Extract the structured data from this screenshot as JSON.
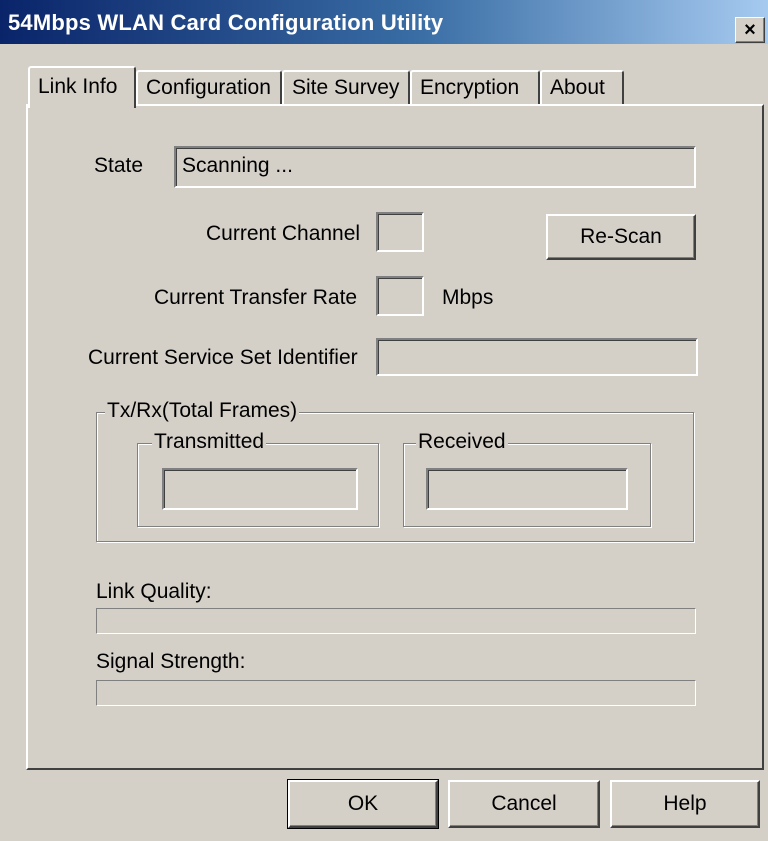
{
  "window": {
    "title": "54Mbps WLAN Card Configuration Utility",
    "close_label": "×"
  },
  "tabs": [
    {
      "label": "Link Info",
      "active": true
    },
    {
      "label": "Configuration",
      "active": false
    },
    {
      "label": "Site Survey",
      "active": false
    },
    {
      "label": "Encryption",
      "active": false
    },
    {
      "label": "About",
      "active": false
    }
  ],
  "link_info": {
    "state_label": "State",
    "state_value": "Scanning ...",
    "channel_label": "Current Channel",
    "channel_value": "",
    "rescan_label": "Re-Scan",
    "rate_label": "Current Transfer Rate",
    "rate_value": "",
    "rate_unit": "Mbps",
    "ssid_label": "Current Service Set Identifier",
    "ssid_value": "",
    "frames_group": "Tx/Rx(Total Frames)",
    "transmitted_label": "Transmitted",
    "transmitted_value": "",
    "received_label": "Received",
    "received_value": "",
    "link_quality_label": "Link Quality:",
    "link_quality_level": 0,
    "signal_strength_label": "Signal Strength:",
    "signal_strength_level": 0
  },
  "footer": {
    "ok_label": "OK",
    "cancel_label": "Cancel",
    "help_label": "Help"
  }
}
